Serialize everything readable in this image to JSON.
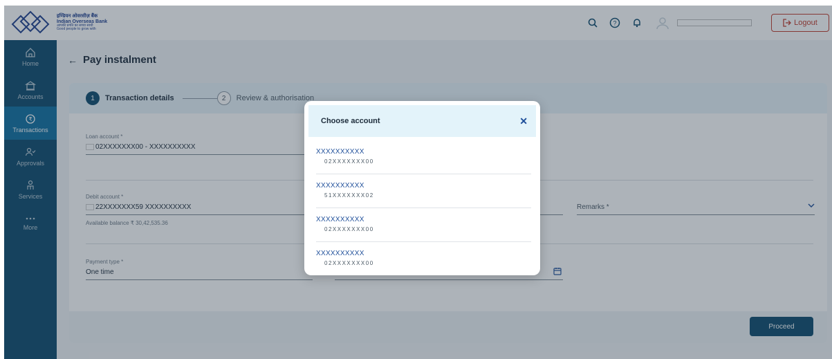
{
  "header": {
    "brand_line1": "इण्डियन ओवरसीज़ बैंक",
    "brand_line2": "Indian Overseas Bank",
    "brand_line3": "आपकी प्रगति का सच्चा साथी",
    "brand_line4": "Good people to grow with",
    "logout_label": "Logout"
  },
  "sidebar": {
    "items": [
      {
        "label": "Home",
        "icon": "home-icon"
      },
      {
        "label": "Accounts",
        "icon": "bank-icon"
      },
      {
        "label": "Transactions",
        "icon": "rupee-exchange-icon"
      },
      {
        "label": "Approvals",
        "icon": "users-check-icon"
      },
      {
        "label": "Services",
        "icon": "service-hand-icon"
      },
      {
        "label": "More",
        "icon": "more-dots-icon"
      }
    ]
  },
  "main": {
    "title": "Pay instalment",
    "steps": [
      {
        "num": "1",
        "label": "Transaction details"
      },
      {
        "num": "2",
        "label": "Review & authorisation"
      }
    ],
    "loan_account": {
      "label": "Loan account *",
      "value": "02XXXXXXX00 - XXXXXXXXXX"
    },
    "debit_account": {
      "label": "Debit account *",
      "value": "22XXXXXXX59 XXXXXXXXXX",
      "balance": "Available balance ₹ 30,42,535.36"
    },
    "remarks": {
      "placeholder": "Remarks *"
    },
    "payment_type": {
      "label": "Payment type *",
      "value": "One time"
    },
    "proceed_label": "Proceed"
  },
  "modal": {
    "title": "Choose account",
    "accounts": [
      {
        "name": "XXXXXXXXXX",
        "number": "02XXXXXXX00"
      },
      {
        "name": "XXXXXXXXXX",
        "number": "51XXXXXXX02"
      },
      {
        "name": "XXXXXXXXXX",
        "number": "02XXXXXXX00"
      },
      {
        "name": "XXXXXXXXXX",
        "number": "02XXXXXXX00"
      }
    ]
  },
  "colors": {
    "primary": "#0c4a6c",
    "active_nav": "#0e6fa0",
    "logout": "#c0392b",
    "link": "#1f4f9a"
  }
}
